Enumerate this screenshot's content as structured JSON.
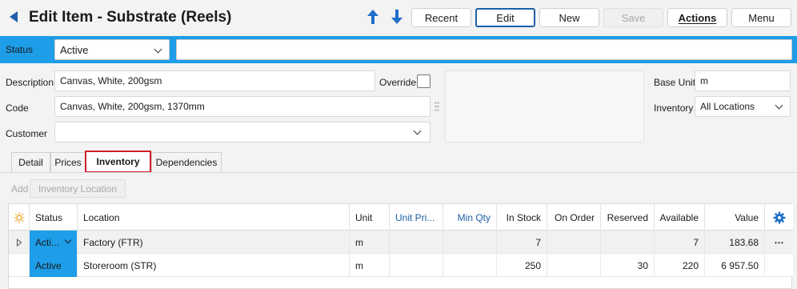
{
  "header": {
    "title": "Edit Item - Substrate (Reels)",
    "buttons": {
      "recent": "Recent",
      "edit": "Edit",
      "new": "New",
      "save": "Save",
      "actions": "Actions",
      "menu": "Menu"
    }
  },
  "status_bar": {
    "label": "Status",
    "value": "Active",
    "note": ""
  },
  "form": {
    "description_label": "Description",
    "description_value": "Canvas, White, 200gsm",
    "override_label": "Override",
    "override_checked": false,
    "code_label": "Code",
    "code_value": "Canvas, White, 200gsm, 1370mm",
    "customer_label": "Customer",
    "customer_value": "",
    "base_unit_label": "Base Unit",
    "base_unit_value": "m",
    "inventory_label": "Inventory",
    "inventory_value": "All Locations"
  },
  "tabs": [
    "Detail",
    "Prices",
    "Inventory",
    "Dependencies"
  ],
  "active_tab": "Inventory",
  "toolbar": {
    "add_label": "Add",
    "inventory_location_label": "Inventory Location"
  },
  "grid": {
    "columns": [
      "Status",
      "Location",
      "Unit",
      "Unit Pri...",
      "Min Qty",
      "In Stock",
      "On Order",
      "Reserved",
      "Available",
      "Value"
    ],
    "rows": [
      {
        "status": "Acti...",
        "location": "Factory (FTR)",
        "unit": "m",
        "unit_price": "",
        "min_qty": "",
        "in_stock": "7",
        "on_order": "",
        "reserved": "",
        "available": "7",
        "value": "183.68",
        "more": "⋯"
      },
      {
        "status": "Active",
        "location": "Storeroom (STR)",
        "unit": "m",
        "unit_price": "",
        "min_qty": "",
        "in_stock": "250",
        "on_order": "",
        "reserved": "30",
        "available": "220",
        "value": "6 957.50",
        "more": ""
      }
    ]
  },
  "colors": {
    "accent": "#1e9de8",
    "brand_blue": "#1f5fa8",
    "active_tab_outline": "#d0202a"
  }
}
